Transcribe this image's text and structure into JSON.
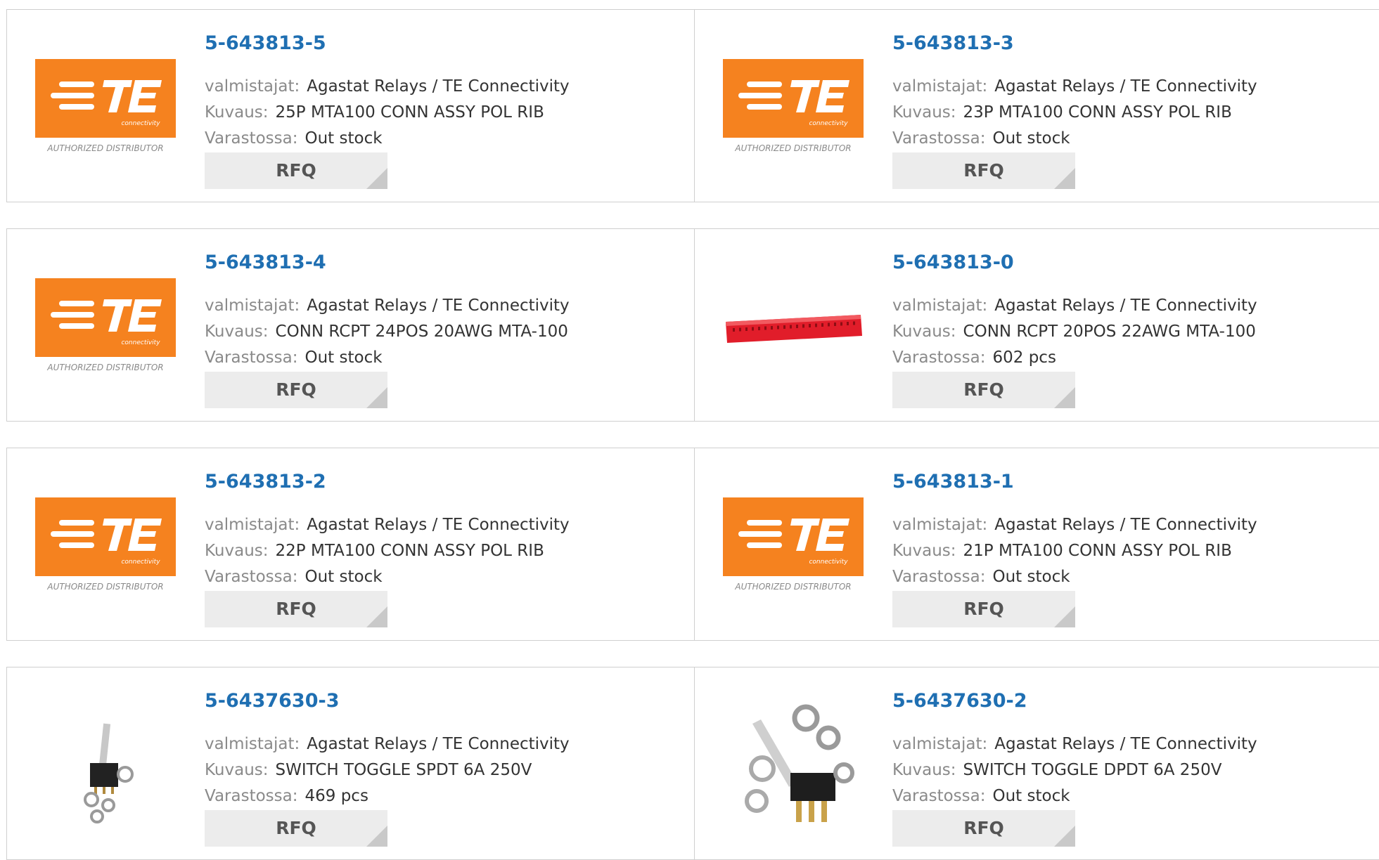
{
  "labels": {
    "manufacturer": "valmistajat:",
    "description": "Kuvaus:",
    "stock": "Varastossa:",
    "rfq": "RFQ"
  },
  "logo": {
    "brand": "TE",
    "sub": "connectivity",
    "tagline": "AUTHORIZED DISTRIBUTOR",
    "color": "#f5821f"
  },
  "products": [
    {
      "part": "5-643813-5",
      "manufacturer": "Agastat Relays / TE Connectivity",
      "description": "25P MTA100 CONN ASSY POL RIB",
      "stock": "Out stock",
      "image": "te-logo"
    },
    {
      "part": "5-643813-3",
      "manufacturer": "Agastat Relays / TE Connectivity",
      "description": "23P MTA100 CONN ASSY POL RIB",
      "stock": "Out stock",
      "image": "te-logo"
    },
    {
      "part": "5-643813-4",
      "manufacturer": "Agastat Relays / TE Connectivity",
      "description": "CONN RCPT 24POS 20AWG MTA-100",
      "stock": "Out stock",
      "image": "te-logo"
    },
    {
      "part": "5-643813-0",
      "manufacturer": "Agastat Relays / TE Connectivity",
      "description": "CONN RCPT 20POS 22AWG MTA-100",
      "stock": "602 pcs",
      "image": "red-connector"
    },
    {
      "part": "5-643813-2",
      "manufacturer": "Agastat Relays / TE Connectivity",
      "description": "22P MTA100 CONN ASSY POL RIB",
      "stock": "Out stock",
      "image": "te-logo"
    },
    {
      "part": "5-643813-1",
      "manufacturer": "Agastat Relays / TE Connectivity",
      "description": "21P MTA100 CONN ASSY POL RIB",
      "stock": "Out stock",
      "image": "te-logo"
    },
    {
      "part": "5-6437630-3",
      "manufacturer": "Agastat Relays / TE Connectivity",
      "description": "SWITCH TOGGLE SPDT 6A 250V",
      "stock": "469 pcs",
      "image": "toggle-switch-small"
    },
    {
      "part": "5-6437630-2",
      "manufacturer": "Agastat Relays / TE Connectivity",
      "description": "SWITCH TOGGLE DPDT 6A 250V",
      "stock": "Out stock",
      "image": "toggle-switch-large"
    }
  ]
}
